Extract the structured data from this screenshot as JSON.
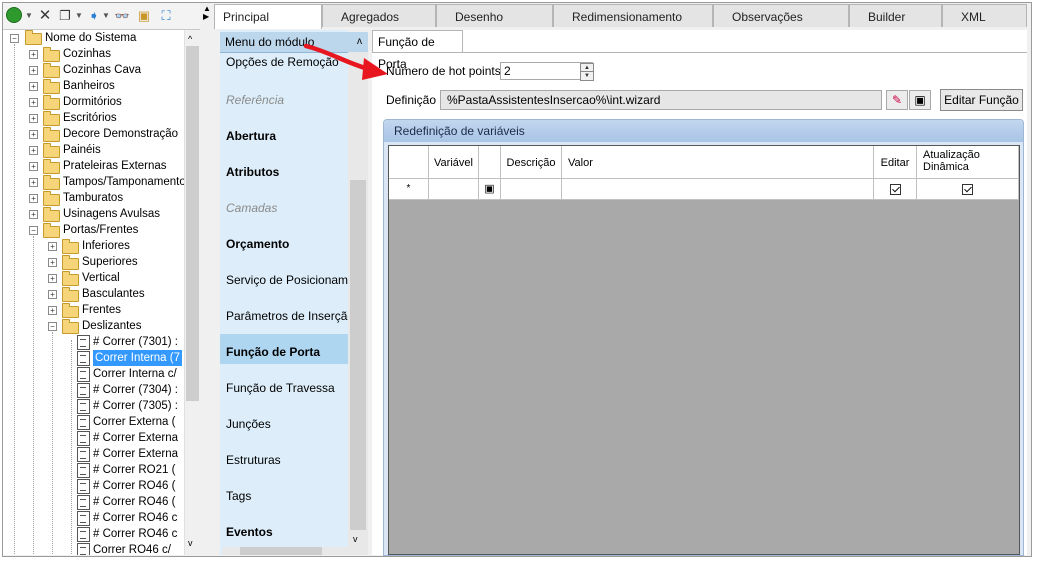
{
  "tree": {
    "root": "Nome do Sistema",
    "items": [
      "Cozinhas",
      "Cozinhas Cava",
      "Banheiros",
      "Dormitórios",
      "Escritórios",
      "Decore Demonstração",
      "Painéis",
      "Prateleiras Externas",
      "Tampos/Tamponamento",
      "Tamburatos",
      "Usinagens Avulsas",
      "Portas/Frentes"
    ],
    "subfolders": [
      "Inferiores",
      "Superiores",
      "Vertical",
      "Basculantes",
      "Frentes",
      "Deslizantes"
    ],
    "docs": [
      "# Correr (7301) :",
      "Correr Interna (7",
      "Correr Interna c/",
      "# Correr (7304) :",
      "# Correr (7305) :",
      "Correr Externa (",
      "# Correr Externa",
      "# Correr Externa",
      "# Correr RO21 (",
      "# Correr RO46 (",
      "# Correr RO46 (",
      "# Correr RO46 c",
      "# Correr RO46 c",
      "Correr RO46 c/"
    ]
  },
  "tabs": [
    "Principal",
    "Agregados",
    "Desenho",
    "Redimensionamento",
    "Observações",
    "Builder",
    "XML"
  ],
  "menu": {
    "header": "Menu do módulo",
    "items": [
      {
        "label": "Opções de Remoção",
        "style": "normal"
      },
      {
        "label": "Referência",
        "style": "gray"
      },
      {
        "label": "Abertura",
        "style": "bold"
      },
      {
        "label": "Atributos",
        "style": "bold"
      },
      {
        "label": "Camadas",
        "style": "gray"
      },
      {
        "label": "Orçamento",
        "style": "bold"
      },
      {
        "label": "Serviço de Posicionamen",
        "style": "normal"
      },
      {
        "label": "Parâmetros de Inserção",
        "style": "normal"
      },
      {
        "label": "Função de Porta",
        "style": "bold"
      },
      {
        "label": "Função de Travessa",
        "style": "normal"
      },
      {
        "label": "Junções",
        "style": "normal"
      },
      {
        "label": "Estruturas",
        "style": "normal"
      },
      {
        "label": "Tags",
        "style": "normal"
      },
      {
        "label": "Eventos",
        "style": "bold"
      }
    ]
  },
  "panel": {
    "subtab": "Função de Porta",
    "hotpoints_label": "Número de hot points",
    "hotpoints_value": "2",
    "definicao_label": "Definição",
    "definicao_value": "%PastaAssistentesInsercao%\\int.wizard",
    "edit_button": "Editar Função",
    "group_title": "Redefinição de variáveis",
    "columns": [
      "Variável",
      "Descrição",
      "Valor",
      "Editar",
      "Atualização",
      "Dinâmica"
    ],
    "new_row_marker": "*"
  },
  "colors": {
    "selection": "#3399ff",
    "menu_bg": "#ddeefa",
    "arrow": "#e8171f"
  }
}
